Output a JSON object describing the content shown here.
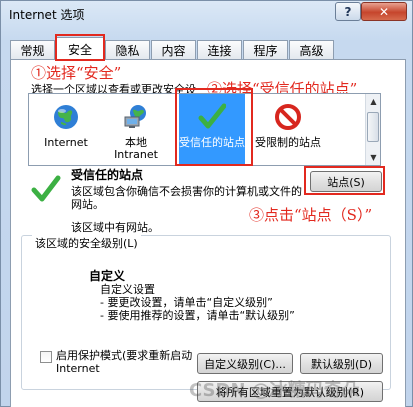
{
  "window": {
    "title": "Internet 选项",
    "help_label": "?",
    "close_label": "✕"
  },
  "tabs": [
    {
      "label": "常规"
    },
    {
      "label": "安全"
    },
    {
      "label": "隐私"
    },
    {
      "label": "内容"
    },
    {
      "label": "连接"
    },
    {
      "label": "程序"
    },
    {
      "label": "高级"
    }
  ],
  "active_tab": "安全",
  "annotations": {
    "step1": "①选择“安全”",
    "step2": "②选择“受信任的站点”",
    "step3": "③点击“站点（S）”"
  },
  "zone_instruction": "选择一个区域以查看或更改安全设",
  "zones": [
    {
      "label": "Internet",
      "icon": "globe-icon"
    },
    {
      "label": "本地\nIntranet",
      "icon": "intranet-icon"
    },
    {
      "label": "受信任的站点",
      "icon": "trusted-check-icon",
      "selected": true
    },
    {
      "label": "受限制的站点",
      "icon": "restricted-icon"
    }
  ],
  "selected_zone": {
    "title": "受信任的站点",
    "description": "该区域包含你确信不会损害你的计算机或文件的网站。",
    "note": "该区域中有网站。",
    "sites_button": "站点(S)"
  },
  "security_level": {
    "group_title": "该区域的安全级别(L)",
    "level_name": "自定义",
    "lines": [
      "自定义设置",
      "- 要更改设置，请单击“自定义级别”",
      "- 要使用推荐的设置，请单击“默认级别”"
    ]
  },
  "protected_mode": {
    "label": "启用保护模式(要求重新启动 Internet",
    "checked": false
  },
  "buttons": {
    "custom_level": "自定义级别(C)...",
    "default_level": "默认级别(D)",
    "reset_all": "将所有区域重置为默认级别(R)"
  },
  "watermark": "CSDN @冰糖码奇朵",
  "colors": {
    "annotation_red": "#e2291f",
    "selection_blue": "#3399ff",
    "check_green": "#3cb043"
  }
}
